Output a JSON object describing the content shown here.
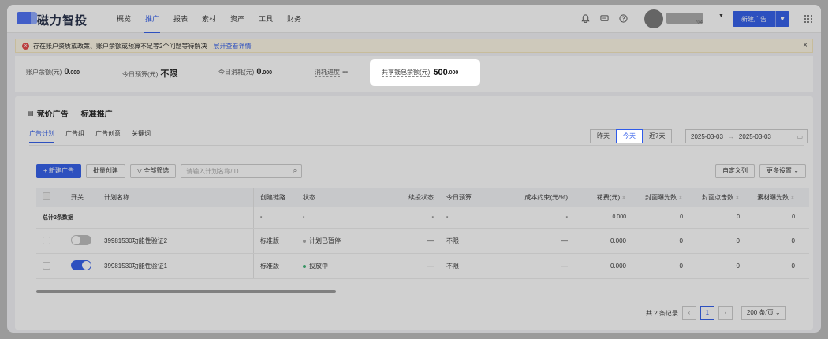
{
  "header": {
    "brand": "磁力智投",
    "nav": [
      "概览",
      "推广",
      "报表",
      "素材",
      "资产",
      "工具",
      "财务"
    ],
    "active_nav": 1,
    "username_suffix": "704",
    "new_ad_label": "新建广告",
    "icons": [
      "bell-icon",
      "message-icon",
      "help-icon",
      "apps-grid-icon"
    ]
  },
  "alert": {
    "text": "存在账户资质或政策、账户余额或预算不足等2个问题等待解决",
    "link": "展开查看详情"
  },
  "stats": {
    "balance_label": "账户余额(元)",
    "balance_value": "0",
    "balance_dec": ".000",
    "budget_label": "今日预算(元)",
    "budget_value": "不限",
    "spend_label": "今日消耗(元)",
    "spend_value": "0",
    "spend_dec": ".000",
    "progress_label": "消耗进度",
    "progress_value": "--",
    "shared_label": "共享钱包余额(元)",
    "shared_value": "500",
    "shared_dec": ".000"
  },
  "type_tabs": [
    "竞价广告",
    "标准推广"
  ],
  "sub_tabs": [
    "广告计划",
    "广告组",
    "广告创意",
    "关键词"
  ],
  "date_segments": [
    "昨天",
    "今天",
    "近7天"
  ],
  "date_range": {
    "start": "2025-03-03",
    "end": "2025-03-03"
  },
  "toolbar": {
    "new_plan": "+ 新建广告",
    "batch_create": "批量创建",
    "filter": "全部筛选",
    "search_placeholder": "请输入计划名称/ID",
    "custom_columns": "自定义列",
    "more_settings": "更多设置"
  },
  "table": {
    "headers": [
      "开关",
      "计划名称",
      "创建链路",
      "状态",
      "续投状态",
      "今日预算",
      "成本约束(元/%)",
      "花费(元)",
      "封面曝光数",
      "封面点击数",
      "素材曝光数"
    ],
    "total": {
      "label": "总计2条数据",
      "c3": "-",
      "c4": "-",
      "c5": "-",
      "c6": "-",
      "c7": "-",
      "c8": "0.000",
      "c9": "0",
      "c10": "0",
      "c11": "0"
    },
    "rows": [
      {
        "on": false,
        "name": "39981530功能性验证2",
        "chain": "标准版",
        "status": "计划已暂停",
        "status_color": "#aaaaaa",
        "renew": "—",
        "budget": "不限",
        "cost": "—",
        "spend": "0.000",
        "cov_imp": "0",
        "cov_clk": "0",
        "mat_imp": "0"
      },
      {
        "on": true,
        "name": "39981530功能性验证1",
        "chain": "标准版",
        "status": "投放中",
        "status_color": "#3bb273",
        "renew": "—",
        "budget": "不限",
        "cost": "—",
        "spend": "0.000",
        "cov_imp": "0",
        "cov_clk": "0",
        "mat_imp": "0"
      }
    ]
  },
  "pagination": {
    "total_text": "共 2 条记录",
    "current": "1",
    "page_size": "200 条/页"
  }
}
